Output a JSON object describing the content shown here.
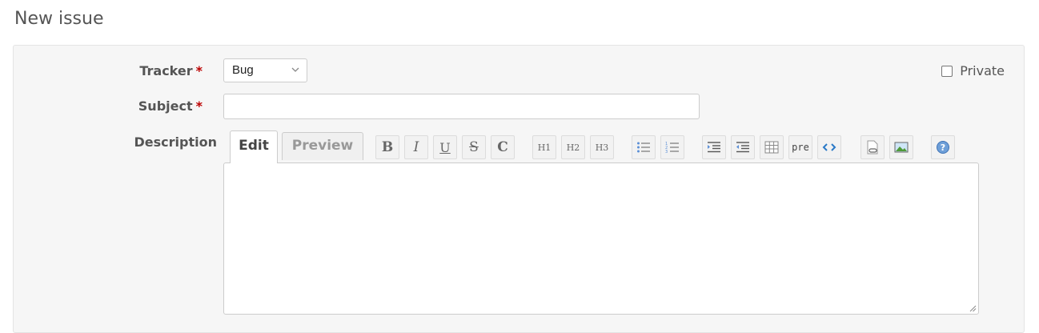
{
  "page": {
    "title": "New issue"
  },
  "form": {
    "tracker": {
      "label": "Tracker",
      "required_mark": "*",
      "value": "Bug"
    },
    "private": {
      "label": "Private",
      "checked": false
    },
    "subject": {
      "label": "Subject",
      "required_mark": "*",
      "value": ""
    },
    "description": {
      "label": "Description",
      "tabs": {
        "edit": "Edit",
        "preview": "Preview"
      },
      "toolbar": {
        "bold": "B",
        "italic": "I",
        "underline": "U",
        "strike": "S",
        "code": "C",
        "h1": "H1",
        "h2": "H2",
        "h3": "H3",
        "pre": "pre"
      },
      "value": ""
    }
  },
  "colors": {
    "required": "#bb0000",
    "accent": "#2a79c7"
  }
}
